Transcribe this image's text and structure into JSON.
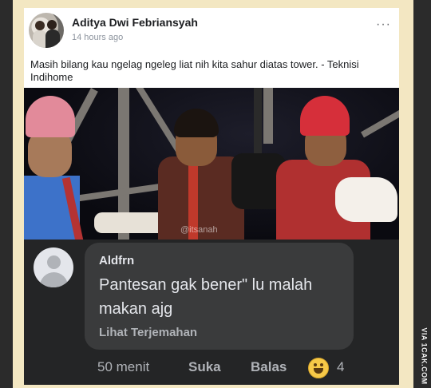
{
  "post": {
    "author": "Aditya Dwi Febriansyah",
    "time": "14 hours ago",
    "more": "···",
    "caption": "Masih bilang kau ngelag ngeleg liat nih kita sahur diatas tower. - Teknisi Indihome",
    "photo_watermark": "@itsanah"
  },
  "comment": {
    "name": "Aldfrn",
    "text": "Pantesan gak bener\" lu malah makan ajg",
    "translate": "Lihat Terjemahan",
    "time": "50 menit",
    "like": "Suka",
    "reply": "Balas",
    "reaction_icon": "haha-emoji-icon",
    "reaction_count": "4"
  },
  "watermark": "VIA 1CAK.COM",
  "colors": {
    "background": "#f3e7c2",
    "comment_bg": "#242526",
    "bubble_bg": "#3a3b3c",
    "text_light": "#e4e6eb",
    "text_muted": "#b0b3b8"
  }
}
